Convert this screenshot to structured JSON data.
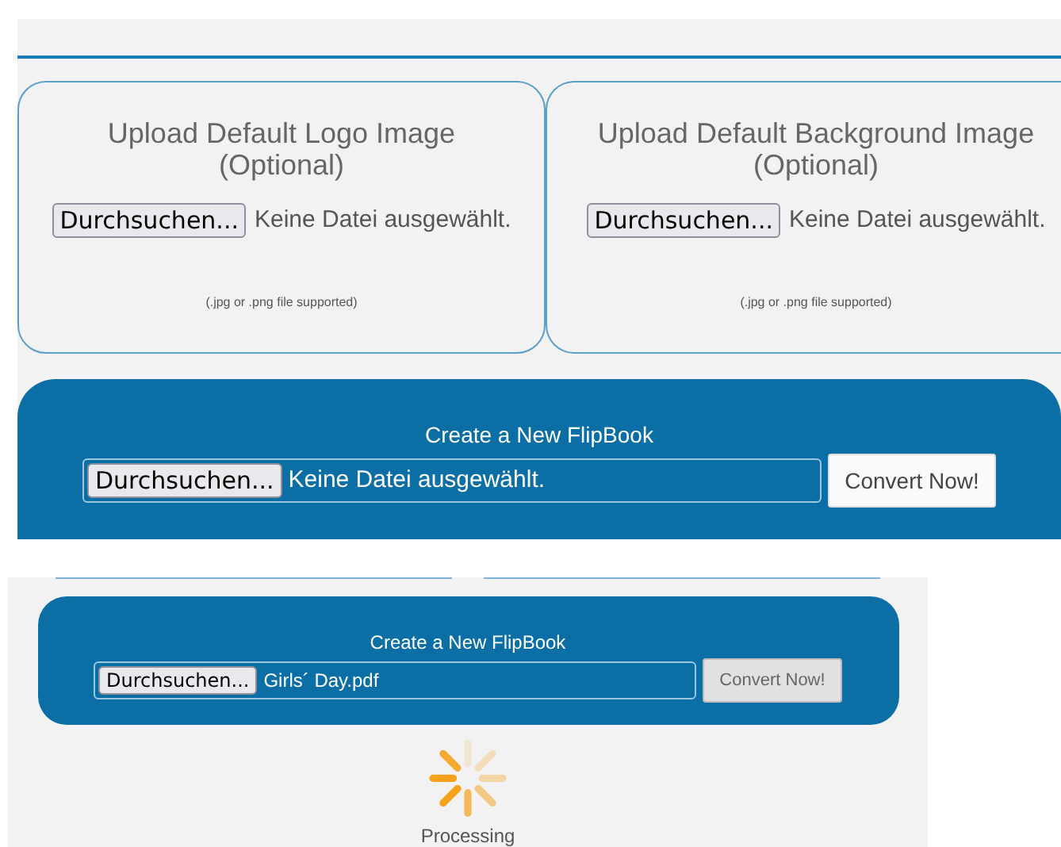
{
  "screenshot_1": {
    "upload_cards": [
      {
        "title": "Upload Default Logo Image",
        "subtitle": "(Optional)",
        "browse_button": "Durchsuchen...",
        "file_status": "Keine Datei ausgewählt.",
        "hint": "(.jpg or .png file supported)"
      },
      {
        "title": "Upload Default Background Image",
        "subtitle": "(Optional)",
        "browse_button": "Durchsuchen...",
        "file_status": "Keine Datei ausgewählt.",
        "hint": "(.jpg or .png file supported)"
      }
    ],
    "create_panel": {
      "title": "Create a New FlipBook",
      "browse_button": "Durchsuchen...",
      "file_status": "Keine Datei ausgewählt.",
      "convert_button": "Convert Now!",
      "convert_disabled": false
    }
  },
  "screenshot_2": {
    "create_panel": {
      "title": "Create a New FlipBook",
      "browse_button": "Durchsuchen...",
      "file_status": "Girls´ Day.pdf",
      "convert_button": "Convert Now!",
      "convert_disabled": true
    },
    "progress": {
      "label": "Processing"
    }
  }
}
